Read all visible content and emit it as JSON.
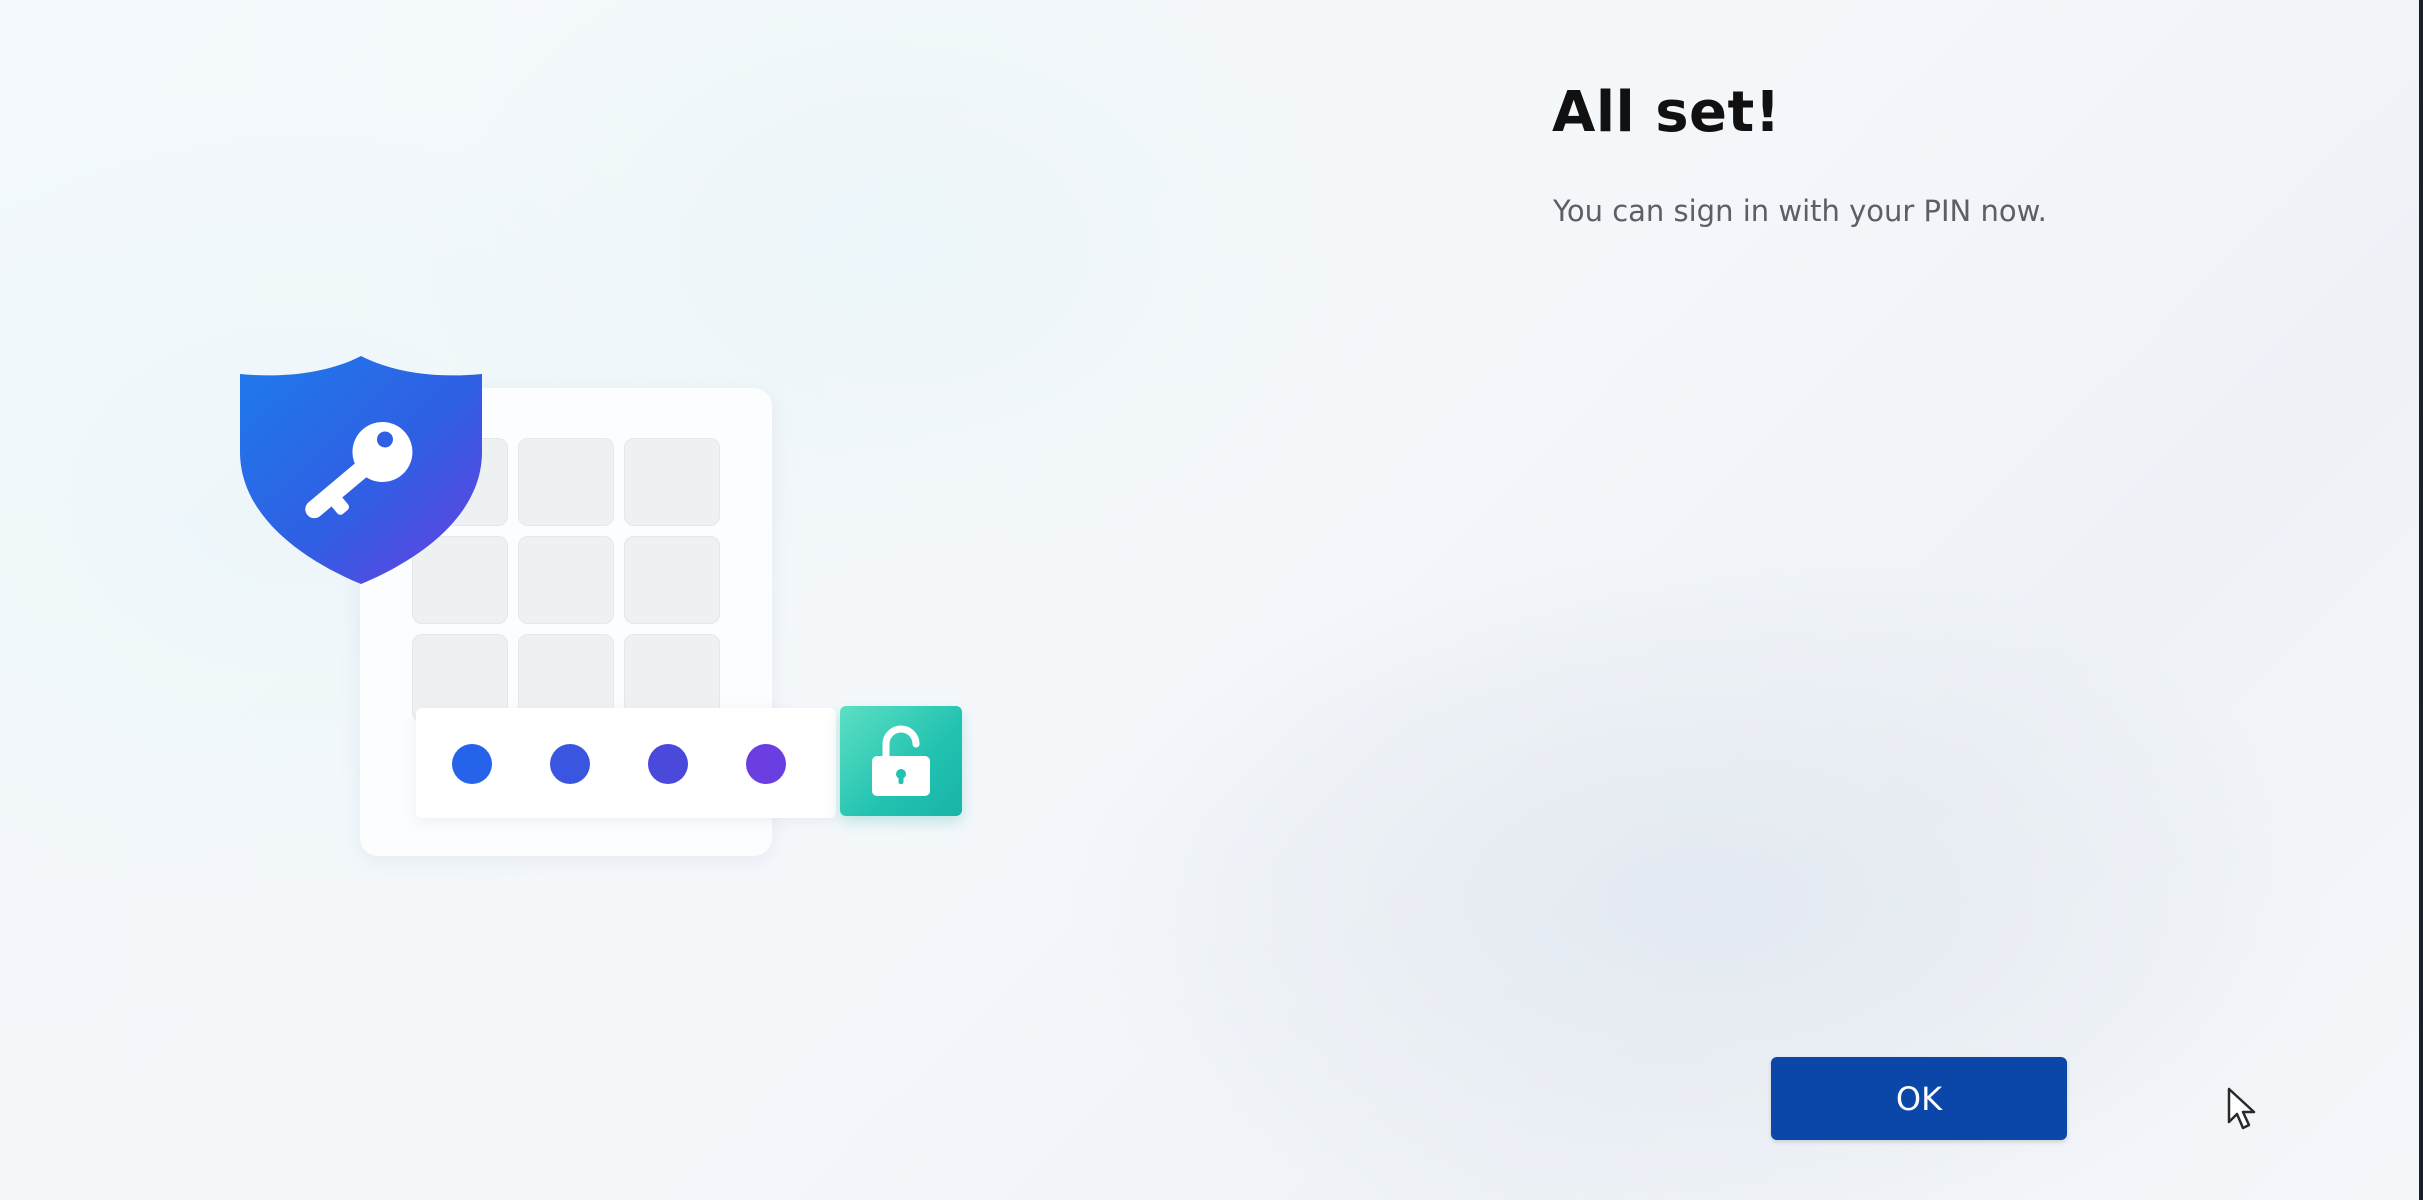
{
  "dialog": {
    "title": "All set!",
    "message": "You can sign in with your PIN now."
  },
  "actions": {
    "ok_label": "OK"
  },
  "illustration": {
    "icons": [
      "shield-key-icon",
      "keypad-grid",
      "pin-dots",
      "unlocked-padlock-icon"
    ],
    "pin_dot_count": 4,
    "pin_dot_colors": [
      "#2563eb",
      "#3a55e0",
      "#4b48dc",
      "#6a3ee0"
    ],
    "shield_gradient": [
      "#1f6fe5",
      "#6a3ee0"
    ],
    "lock_color": "#22c2b0"
  },
  "colors": {
    "primary_button": "#0a47a8",
    "title_text": "#111111",
    "body_text": "#5c5f63"
  },
  "cursor": "arrow-pointer-icon"
}
